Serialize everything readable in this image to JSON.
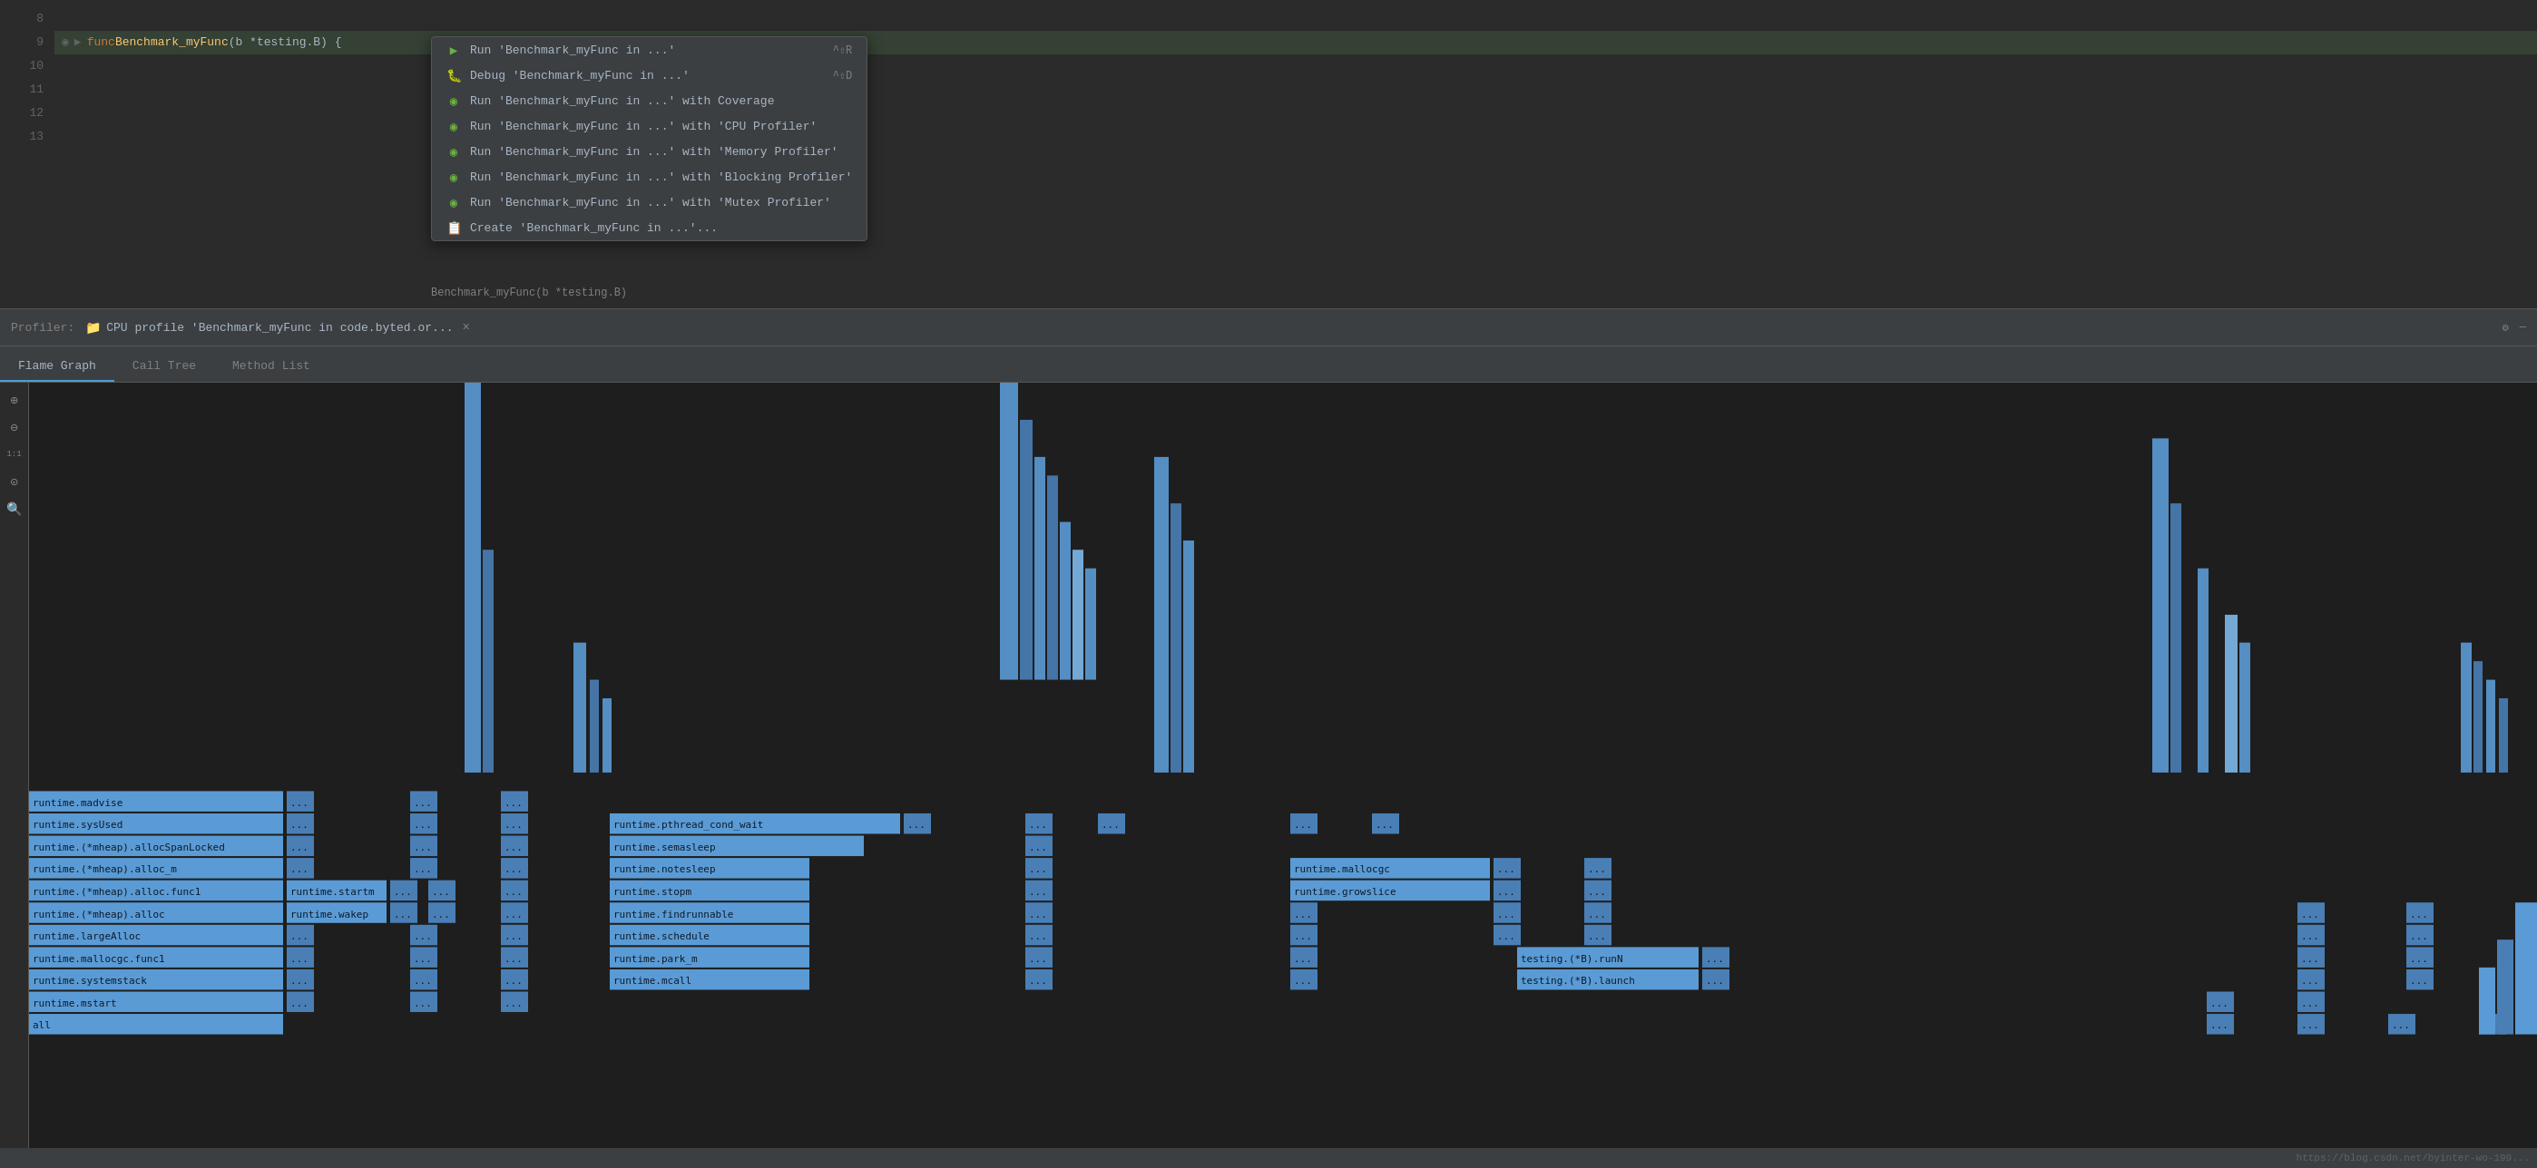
{
  "editor": {
    "lines": [
      {
        "number": "8",
        "content": "",
        "highlighted": false
      },
      {
        "number": "9",
        "content": "func Benchmark_myFunc(b *testing.B) {",
        "highlighted": true
      },
      {
        "number": "10",
        "content": "",
        "highlighted": false
      },
      {
        "number": "11",
        "content": "",
        "highlighted": false
      },
      {
        "number": "12",
        "content": "",
        "highlighted": false
      },
      {
        "number": "13",
        "content": "",
        "highlighted": false
      }
    ]
  },
  "context_menu": {
    "items": [
      {
        "icon": "▶",
        "icon_class": "run-icon",
        "label": "Run 'Benchmark_myFunc in ...'",
        "shortcut": "^⇧R"
      },
      {
        "icon": "🐛",
        "icon_class": "debug-icon",
        "label": "Debug 'Benchmark_myFunc in ...'",
        "shortcut": "^⇧D"
      },
      {
        "icon": "◉",
        "icon_class": "coverage-icon",
        "label": "Run 'Benchmark_myFunc in ...' with Coverage",
        "shortcut": ""
      },
      {
        "icon": "◉",
        "icon_class": "coverage-icon",
        "label": "Run 'Benchmark_myFunc in ...' with 'CPU Profiler'",
        "shortcut": ""
      },
      {
        "icon": "◉",
        "icon_class": "coverage-icon",
        "label": "Run 'Benchmark_myFunc in ...' with 'Memory Profiler'",
        "shortcut": ""
      },
      {
        "icon": "◉",
        "icon_class": "coverage-icon",
        "label": "Run 'Benchmark_myFunc in ...' with 'Blocking Profiler'",
        "shortcut": ""
      },
      {
        "icon": "◉",
        "icon_class": "coverage-icon",
        "label": "Run 'Benchmark_myFunc in ...' with 'Mutex Profiler'",
        "shortcut": ""
      },
      {
        "icon": "📋",
        "icon_class": "create-icon",
        "label": "Create 'Benchmark_myFunc in ...'...",
        "shortcut": ""
      }
    ]
  },
  "function_hint": "Benchmark_myFunc(b *testing.B)",
  "profiler": {
    "label": "Profiler:",
    "tab_name": "CPU profile 'Benchmark_myFunc in code.byted.or...",
    "close_button": "×",
    "settings_icon": "⚙",
    "minimize_icon": "—"
  },
  "tabs": [
    {
      "id": "flame-graph",
      "label": "Flame Graph",
      "active": true
    },
    {
      "id": "call-tree",
      "label": "Call Tree",
      "active": false
    },
    {
      "id": "method-list",
      "label": "Method List",
      "active": false
    }
  ],
  "controls": [
    {
      "icon": "⊕",
      "name": "zoom-in",
      "label": ""
    },
    {
      "icon": "⊖",
      "name": "zoom-out",
      "label": ""
    },
    {
      "icon": "1:1",
      "name": "reset-zoom",
      "label": "1:1"
    },
    {
      "icon": "⊙",
      "name": "focus",
      "label": ""
    },
    {
      "icon": "🔍",
      "name": "search",
      "label": ""
    }
  ],
  "flame_functions": {
    "bottom_rows": [
      {
        "row": 1,
        "items": [
          {
            "label": "runtime.madvise",
            "left_pct": 0,
            "width_pct": 9.5,
            "style": "dark"
          },
          {
            "label": "...",
            "left_pct": 10.5,
            "width_pct": 0.5,
            "style": "dots"
          },
          {
            "label": "...",
            "left_pct": 15,
            "width_pct": 0.5,
            "style": "dots"
          },
          {
            "label": "...",
            "left_pct": 19,
            "width_pct": 0.5,
            "style": "dots"
          }
        ]
      },
      {
        "row": 2,
        "items": [
          {
            "label": "runtime.sysUsed",
            "left_pct": 0,
            "width_pct": 9.5,
            "style": "dark"
          },
          {
            "label": "...",
            "left_pct": 10.5,
            "width_pct": 0.5,
            "style": "dots"
          },
          {
            "label": "...",
            "left_pct": 15,
            "width_pct": 0.5,
            "style": "dots"
          },
          {
            "label": "...",
            "left_pct": 19,
            "width_pct": 0.5,
            "style": "dots"
          },
          {
            "label": "runtime.pthread_cond_wait",
            "left_pct": 23,
            "width_pct": 10,
            "style": "dark"
          },
          {
            "label": "...",
            "left_pct": 33.5,
            "width_pct": 0.5,
            "style": "dots"
          },
          {
            "label": "...",
            "left_pct": 38,
            "width_pct": 0.5,
            "style": "dots"
          },
          {
            "label": "...",
            "left_pct": 42,
            "width_pct": 0.5,
            "style": "dots"
          },
          {
            "label": "...",
            "left_pct": 51,
            "width_pct": 0.5,
            "style": "dots"
          },
          {
            "label": "...",
            "left_pct": 55,
            "width_pct": 0.5,
            "style": "dots"
          }
        ]
      },
      {
        "row": 3,
        "items": [
          {
            "label": "runtime.(*mheap).allocSpanLocked",
            "left_pct": 0,
            "width_pct": 9.5,
            "style": "dark"
          },
          {
            "label": "...",
            "left_pct": 10.5,
            "width_pct": 0.5,
            "style": "dots"
          },
          {
            "label": "...",
            "left_pct": 15,
            "width_pct": 0.5,
            "style": "dots"
          },
          {
            "label": "...",
            "left_pct": 19,
            "width_pct": 0.5,
            "style": "dots"
          },
          {
            "label": "runtime.semasleep",
            "left_pct": 23,
            "width_pct": 10,
            "style": "dark"
          },
          {
            "label": "...",
            "left_pct": 38,
            "width_pct": 0.5,
            "style": "dots"
          }
        ]
      },
      {
        "row": 4,
        "items": [
          {
            "label": "runtime.(*mheap).alloc_m",
            "left_pct": 0,
            "width_pct": 9.5,
            "style": "dark"
          },
          {
            "label": "...",
            "left_pct": 10.5,
            "width_pct": 0.5,
            "style": "dots"
          },
          {
            "label": "...",
            "left_pct": 15,
            "width_pct": 0.5,
            "style": "dots"
          },
          {
            "label": "...",
            "left_pct": 19,
            "width_pct": 0.5,
            "style": "dots"
          },
          {
            "label": "runtime.notesleep",
            "left_pct": 23,
            "width_pct": 8,
            "style": "dark"
          },
          {
            "label": "...",
            "left_pct": 38,
            "width_pct": 0.5,
            "style": "dots"
          },
          {
            "label": "runtime.mallocgc",
            "left_pct": 51,
            "width_pct": 8,
            "style": "dark"
          },
          {
            "label": "...",
            "left_pct": 59.5,
            "width_pct": 0.5,
            "style": "dots"
          },
          {
            "label": "...",
            "left_pct": 63,
            "width_pct": 0.5,
            "style": "dots"
          }
        ]
      },
      {
        "row": 5,
        "items": [
          {
            "label": "runtime.(*mheap).alloc.func1",
            "left_pct": 0,
            "width_pct": 9.5,
            "style": "dark"
          },
          {
            "label": "runtime.startm",
            "left_pct": 10.5,
            "width_pct": 4,
            "style": "dark"
          },
          {
            "label": "...",
            "left_pct": 15,
            "width_pct": 0.5,
            "style": "dots"
          },
          {
            "label": "...",
            "left_pct": 19,
            "width_pct": 0.5,
            "style": "dots"
          },
          {
            "label": "runtime.stopm",
            "left_pct": 23,
            "width_pct": 8,
            "style": "dark"
          },
          {
            "label": "...",
            "left_pct": 38,
            "width_pct": 0.5,
            "style": "dots"
          },
          {
            "label": "runtime.growslice",
            "left_pct": 51,
            "width_pct": 8,
            "style": "dark"
          },
          {
            "label": "...",
            "left_pct": 59.5,
            "width_pct": 0.5,
            "style": "dots"
          },
          {
            "label": "...",
            "left_pct": 63,
            "width_pct": 0.5,
            "style": "dots"
          }
        ]
      },
      {
        "row": 6,
        "items": [
          {
            "label": "runtime.(*mheap).alloc",
            "left_pct": 0,
            "width_pct": 9.5,
            "style": "dark"
          },
          {
            "label": "runtime.wakep",
            "left_pct": 10.5,
            "width_pct": 4,
            "style": "dark"
          },
          {
            "label": "...",
            "left_pct": 15,
            "width_pct": 0.5,
            "style": "dots"
          },
          {
            "label": "...",
            "left_pct": 19,
            "width_pct": 0.5,
            "style": "dots"
          },
          {
            "label": "runtime.findrunnable",
            "left_pct": 23,
            "width_pct": 8,
            "style": "dark"
          },
          {
            "label": "...",
            "left_pct": 38,
            "width_pct": 0.5,
            "style": "dots"
          },
          {
            "label": "...",
            "left_pct": 51,
            "width_pct": 0.5,
            "style": "dots"
          },
          {
            "label": "...",
            "left_pct": 59.5,
            "width_pct": 0.5,
            "style": "dots"
          },
          {
            "label": "...",
            "left_pct": 63,
            "width_pct": 0.5,
            "style": "dots"
          },
          {
            "label": "...",
            "left_pct": 91,
            "width_pct": 0.5,
            "style": "dots"
          },
          {
            "label": "...",
            "left_pct": 95,
            "width_pct": 0.5,
            "style": "dots"
          }
        ]
      },
      {
        "row": 7,
        "items": [
          {
            "label": "runtime.largeAlloc",
            "left_pct": 0,
            "width_pct": 9.5,
            "style": "dark"
          },
          {
            "label": "...",
            "left_pct": 10.5,
            "width_pct": 0.5,
            "style": "dots"
          },
          {
            "label": "...",
            "left_pct": 15,
            "width_pct": 0.5,
            "style": "dots"
          },
          {
            "label": "...",
            "left_pct": 19,
            "width_pct": 0.5,
            "style": "dots"
          },
          {
            "label": "runtime.schedule",
            "left_pct": 23,
            "width_pct": 8,
            "style": "dark"
          },
          {
            "label": "...",
            "left_pct": 38,
            "width_pct": 0.5,
            "style": "dots"
          },
          {
            "label": "...",
            "left_pct": 51,
            "width_pct": 0.5,
            "style": "dots"
          },
          {
            "label": "...",
            "left_pct": 59.5,
            "width_pct": 0.5,
            "style": "dots"
          },
          {
            "label": "...",
            "left_pct": 63,
            "width_pct": 0.5,
            "style": "dots"
          },
          {
            "label": "...",
            "left_pct": 91,
            "width_pct": 0.5,
            "style": "dots"
          },
          {
            "label": "...",
            "left_pct": 95,
            "width_pct": 0.5,
            "style": "dots"
          }
        ]
      },
      {
        "row": 8,
        "items": [
          {
            "label": "runtime.mallocgc.func1",
            "left_pct": 0,
            "width_pct": 9.5,
            "style": "dark"
          },
          {
            "label": "...",
            "left_pct": 10.5,
            "width_pct": 0.5,
            "style": "dots"
          },
          {
            "label": "...",
            "left_pct": 15,
            "width_pct": 0.5,
            "style": "dots"
          },
          {
            "label": "...",
            "left_pct": 19,
            "width_pct": 0.5,
            "style": "dots"
          },
          {
            "label": "runtime.park_m",
            "left_pct": 23,
            "width_pct": 8,
            "style": "dark"
          },
          {
            "label": "...",
            "left_pct": 38,
            "width_pct": 0.5,
            "style": "dots"
          },
          {
            "label": "...",
            "left_pct": 51,
            "width_pct": 0.5,
            "style": "dots"
          },
          {
            "label": "testing.(*B).runN",
            "left_pct": 59.5,
            "width_pct": 7,
            "style": "dark"
          },
          {
            "label": "...",
            "left_pct": 67,
            "width_pct": 0.5,
            "style": "dots"
          },
          {
            "label": "...",
            "left_pct": 91,
            "width_pct": 0.5,
            "style": "dots"
          },
          {
            "label": "...",
            "left_pct": 95,
            "width_pct": 0.5,
            "style": "dots"
          }
        ]
      },
      {
        "row": 9,
        "items": [
          {
            "label": "runtime.systemstack",
            "left_pct": 0,
            "width_pct": 9.5,
            "style": "dark"
          },
          {
            "label": "...",
            "left_pct": 10.5,
            "width_pct": 0.5,
            "style": "dots"
          },
          {
            "label": "...",
            "left_pct": 15,
            "width_pct": 0.5,
            "style": "dots"
          },
          {
            "label": "...",
            "left_pct": 19,
            "width_pct": 0.5,
            "style": "dots"
          },
          {
            "label": "runtime.mcall",
            "left_pct": 23,
            "width_pct": 8,
            "style": "dark"
          },
          {
            "label": "...",
            "left_pct": 38,
            "width_pct": 0.5,
            "style": "dots"
          },
          {
            "label": "...",
            "left_pct": 51,
            "width_pct": 0.5,
            "style": "dots"
          },
          {
            "label": "testing.(*B).launch",
            "left_pct": 59.5,
            "width_pct": 7,
            "style": "dark"
          },
          {
            "label": "...",
            "left_pct": 67,
            "width_pct": 0.5,
            "style": "dots"
          },
          {
            "label": "...",
            "left_pct": 91,
            "width_pct": 0.5,
            "style": "dots"
          },
          {
            "label": "...",
            "left_pct": 95,
            "width_pct": 0.5,
            "style": "dots"
          }
        ]
      },
      {
        "row": 10,
        "items": [
          {
            "label": "runtime.mstart",
            "left_pct": 0,
            "width_pct": 9.5,
            "style": "dark"
          },
          {
            "label": "...",
            "left_pct": 10.5,
            "width_pct": 0.5,
            "style": "dots"
          },
          {
            "label": "...",
            "left_pct": 15,
            "width_pct": 0.5,
            "style": "dots"
          },
          {
            "label": "...",
            "left_pct": 19,
            "width_pct": 0.5,
            "style": "dots"
          }
        ]
      },
      {
        "row": 11,
        "items": [
          {
            "label": "all",
            "left_pct": 0,
            "width_pct": 9.5,
            "style": "dark"
          }
        ]
      }
    ]
  },
  "status_bar": {
    "url": "https://blog.csdn.net/byinter-wo-199..."
  }
}
